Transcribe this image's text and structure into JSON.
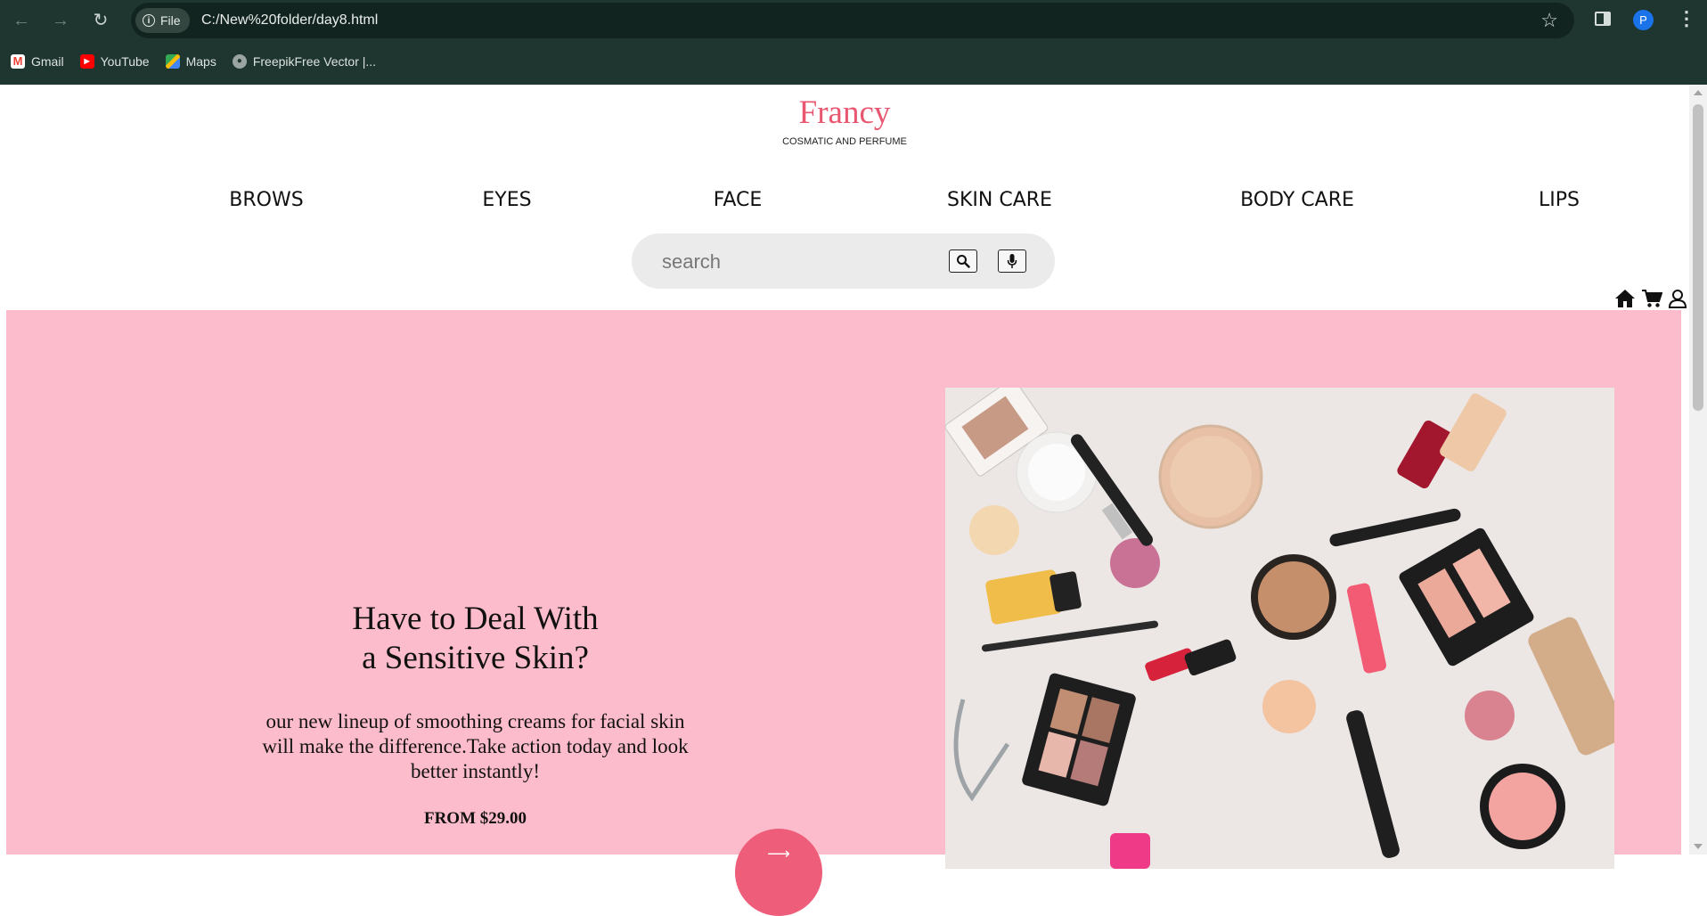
{
  "browser": {
    "file_chip": "File",
    "url": "C:/New%20folder/day8.html",
    "profile_initial": "P",
    "bookmarks": [
      {
        "label": "Gmail",
        "icon": "gmail-icon"
      },
      {
        "label": "YouTube",
        "icon": "youtube-icon"
      },
      {
        "label": "Maps",
        "icon": "maps-icon"
      },
      {
        "label": "FreepikFree Vector |...",
        "icon": "globe-icon"
      }
    ]
  },
  "site": {
    "logo": "Francy",
    "tagline": "COSMATIC AND PERFUME",
    "accent_color": "#e95670",
    "hero_bg_color": "#fdbccb",
    "nav": [
      "BROWS",
      "EYES",
      "FACE",
      "SKIN CARE",
      "BODY CARE",
      "LIPS"
    ],
    "search_placeholder": "search",
    "corner_icons": [
      "home-icon",
      "cart-icon",
      "user-icon"
    ]
  },
  "hero": {
    "title_line1": "Have to Deal With",
    "title_line2": "a Sensitive Skin?",
    "text": "our new lineup of smoothing creams for facial skin will make the difference.Take action today and look better instantly!",
    "price": "FROM $29.00"
  }
}
